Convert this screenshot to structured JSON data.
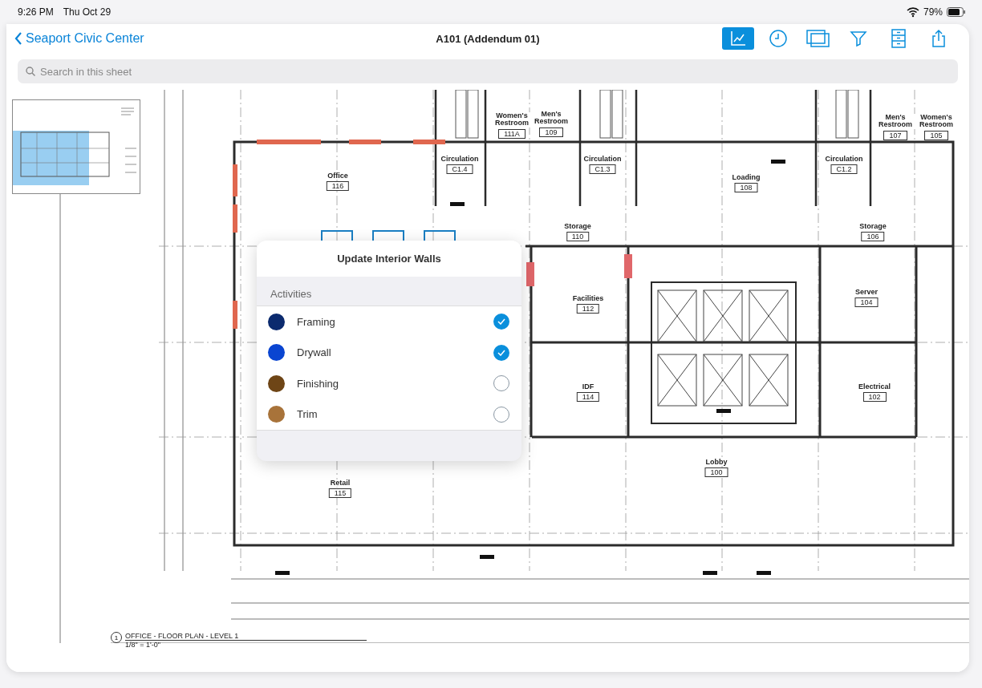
{
  "status_bar": {
    "time": "9:26 PM",
    "date": "Thu Oct 29",
    "battery": "79%"
  },
  "header": {
    "back": "Seaport Civic Center",
    "title": "A101 (Addendum 01)",
    "tools": [
      {
        "kind": "chart",
        "selected": true
      },
      {
        "kind": "clock",
        "selected": false
      },
      {
        "kind": "layers",
        "selected": false
      },
      {
        "kind": "filter",
        "selected": false
      },
      {
        "kind": "cabinet",
        "selected": false
      },
      {
        "kind": "share",
        "selected": false
      }
    ]
  },
  "search": {
    "placeholder": "Search in this sheet"
  },
  "plan": {
    "rooms": [
      {
        "name": "Office",
        "number": "116"
      },
      {
        "name": "Women's Restroom",
        "number": "111A"
      },
      {
        "name": "Men's Restroom",
        "number": "109"
      },
      {
        "name": "Circulation",
        "number": "C1.4"
      },
      {
        "name": "Circulation",
        "number": "C1.3"
      },
      {
        "name": "Loading",
        "number": "108"
      },
      {
        "name": "Circulation",
        "number": "C1.2"
      },
      {
        "name": "Men's Restroom",
        "number": "107"
      },
      {
        "name": "Women's Restroom",
        "number": "105"
      },
      {
        "name": "Storage",
        "number": "110"
      },
      {
        "name": "Storage",
        "number": "106"
      },
      {
        "name": "Facilities",
        "number": "112"
      },
      {
        "name": "Server",
        "number": "104"
      },
      {
        "name": "IDF",
        "number": "114"
      },
      {
        "name": "Electrical",
        "number": "102"
      },
      {
        "name": "Lobby",
        "number": "100"
      },
      {
        "name": "Retail",
        "number": "115"
      }
    ],
    "title_number": "1",
    "title": "OFFICE - FLOOR PLAN - LEVEL 1",
    "scale": "1/8\" = 1'-0\""
  },
  "popover": {
    "title": "Update Interior Walls",
    "section": "Activities",
    "activities": [
      {
        "name": "Framing",
        "color": "#0b2a6e",
        "checked": true
      },
      {
        "name": "Drywall",
        "color": "#0a45d1",
        "checked": true
      },
      {
        "name": "Finishing",
        "color": "#6e4516",
        "checked": false
      },
      {
        "name": "Trim",
        "color": "#a8733a",
        "checked": false
      }
    ]
  }
}
